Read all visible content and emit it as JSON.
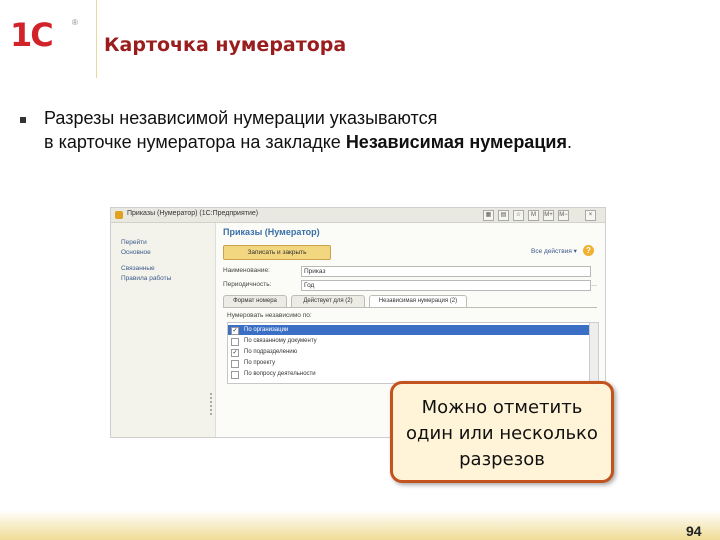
{
  "brand": {
    "logo_text": "1С",
    "reg_mark": "®",
    "accent_color": "#d2232a"
  },
  "slide": {
    "title": "Карточка нумератора",
    "bullet_line1": "Разрезы независимой нумерации указываются",
    "bullet_line2_prefix": "в карточке нумератора на закладке ",
    "bullet_line2_bold": "Независимая нумерация",
    "bullet_line2_suffix": "."
  },
  "app": {
    "window_title": "Приказы (Нумератор) (1С:Предприятие)",
    "window_controls": [
      "▦",
      "▤",
      "☆",
      "M",
      "M+",
      "M−",
      "×"
    ],
    "sidebar": {
      "items": [
        {
          "label": "Перейти",
          "icon": "none"
        },
        {
          "label": "Основное",
          "icon": "none"
        },
        {
          "label": "Связанные",
          "icon": "none"
        },
        {
          "label": "Правила работы",
          "icon": "none"
        }
      ]
    },
    "form_title": "Приказы (Нумератор)",
    "save_button": "Записать и закрыть",
    "more_label": "Все действия ▾",
    "help_icon": "?",
    "fields": [
      {
        "label": "Наименование:",
        "value": "Приказ"
      },
      {
        "label": "Периодичность:",
        "value": "Год"
      }
    ],
    "tabs": [
      {
        "label": "Формат номера",
        "active": false
      },
      {
        "label": "Действует для (2)",
        "active": false
      },
      {
        "label": "Независимая нумерация (2)",
        "active": true
      }
    ],
    "numbering_label": "Нумеровать независимо по:",
    "list_items": [
      {
        "label": "По организации",
        "checked": true,
        "selected": true
      },
      {
        "label": "По связанному документу",
        "checked": false,
        "selected": false
      },
      {
        "label": "По подразделению",
        "checked": true,
        "selected": false
      },
      {
        "label": "По проекту",
        "checked": false,
        "selected": false
      },
      {
        "label": "По вопросу деятельности",
        "checked": false,
        "selected": false
      }
    ]
  },
  "callout": {
    "line1": "Можно отметить",
    "line2": "один или несколько",
    "line3": "разрезов",
    "border_color": "#c2531e",
    "background": "#fff4d8"
  },
  "footer": {
    "page_number": "94"
  }
}
